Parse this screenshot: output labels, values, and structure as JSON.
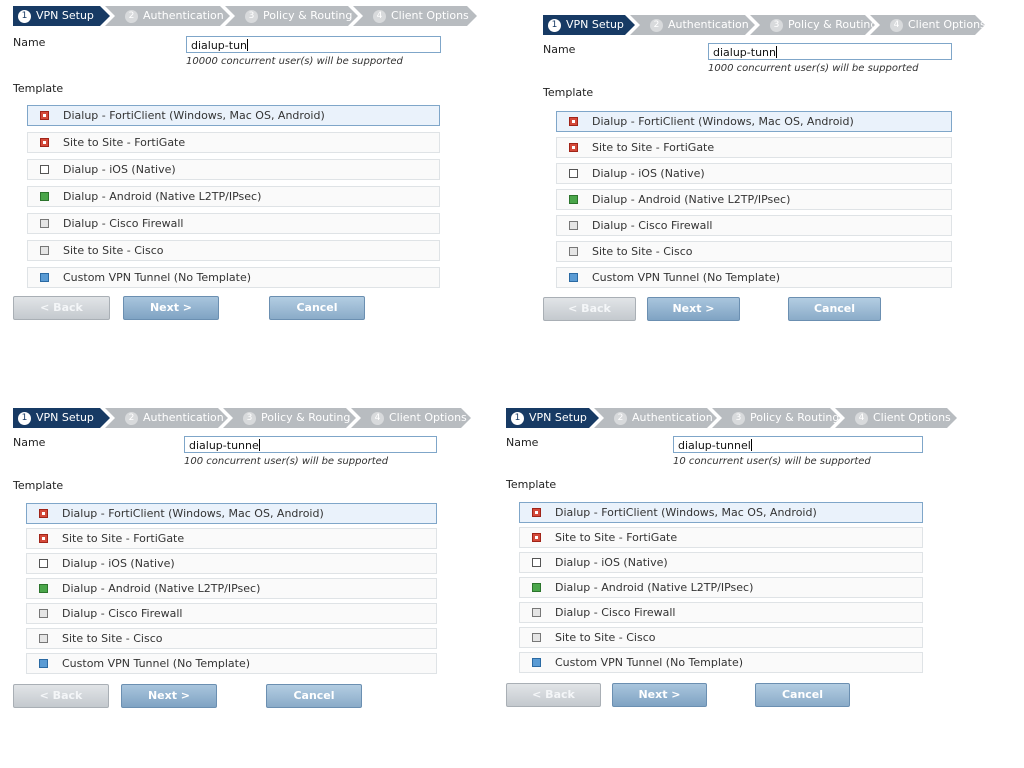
{
  "wizard": {
    "steps": [
      {
        "num": "1",
        "label": "VPN Setup"
      },
      {
        "num": "2",
        "label": "Authentication"
      },
      {
        "num": "3",
        "label": "Policy & Routing"
      },
      {
        "num": "4",
        "label": "Client Options"
      }
    ],
    "name_label": "Name",
    "template_label": "Template",
    "templates": [
      {
        "label": "Dialup - FortiClient (Windows, Mac OS, Android)",
        "icon": "forticlient-icon"
      },
      {
        "label": "Site to Site - FortiGate",
        "icon": "fortigate-icon"
      },
      {
        "label": "Dialup - iOS (Native)",
        "icon": "ios-icon"
      },
      {
        "label": "Dialup - Android (Native L2TP/IPsec)",
        "icon": "android-icon"
      },
      {
        "label": "Dialup - Cisco Firewall",
        "icon": "cisco-icon"
      },
      {
        "label": "Site to Site - Cisco",
        "icon": "cisco-icon"
      },
      {
        "label": "Custom VPN Tunnel (No Template)",
        "icon": "custom-vpn-icon"
      }
    ],
    "back_label": "< Back",
    "next_label": "Next >",
    "cancel_label": "Cancel",
    "active_step_color": "#173a64",
    "inactive_step_color": "#b8bcc0"
  },
  "panels": [
    {
      "name_value": "dialup-tun",
      "hint": "10000 concurrent user(s) will be supported"
    },
    {
      "name_value": "dialup-tunn",
      "hint": "1000 concurrent user(s) will be supported"
    },
    {
      "name_value": "dialup-tunne",
      "hint": "100 concurrent user(s) will be supported"
    },
    {
      "name_value": "dialup-tunnel",
      "hint": "10 concurrent user(s) will be supported"
    }
  ]
}
